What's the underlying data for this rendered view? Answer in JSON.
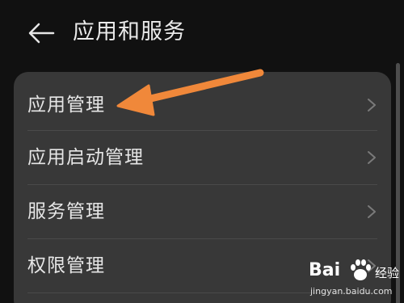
{
  "header": {
    "back_icon": "arrow-left-icon",
    "title": "应用和服务"
  },
  "menu": {
    "items": [
      {
        "label": "应用管理",
        "icon": "chevron-right-icon"
      },
      {
        "label": "应用启动管理",
        "icon": "chevron-right-icon"
      },
      {
        "label": "服务管理",
        "icon": "chevron-right-icon"
      },
      {
        "label": "权限管理",
        "icon": "chevron-right-icon"
      }
    ]
  },
  "annotation": {
    "type": "arrow",
    "color": "#f0883a",
    "points_to": "应用管理"
  },
  "watermark": {
    "brand_prefix": "Bai",
    "brand_suffix": "经验",
    "url": "jingyan.baidu.com",
    "icon": "paw-icon"
  },
  "theme": {
    "background": "#111111",
    "card": "#383838",
    "text": "#e6e6e6",
    "divider": "#4a4a4a",
    "accent_arrow": "#f0883a"
  }
}
